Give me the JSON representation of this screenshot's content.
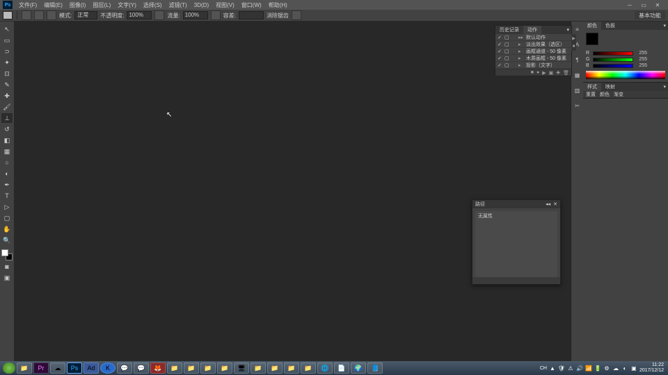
{
  "menubar": {
    "app": "Ps",
    "items": [
      "文件(F)",
      "编辑(E)",
      "图像(I)",
      "图层(L)",
      "文字(Y)",
      "选择(S)",
      "滤镜(T)",
      "3D(D)",
      "视图(V)",
      "窗口(W)",
      "帮助(H)"
    ]
  },
  "optionsbar": {
    "mode_label": "模式:",
    "mode_value": "正常",
    "opacity_label": "不透明度:",
    "opacity_value": "100%",
    "flow_label": "流量:",
    "flow_value": "100%",
    "tolerance_label": "容差:",
    "tolerance_value": "",
    "antialias_label": "消除锯齿",
    "workspace_switch": "基本功能"
  },
  "actions_panel": {
    "tab1": "历史记录",
    "tab2": "动作",
    "rows": [
      {
        "name": "默认动作",
        "folder": true
      },
      {
        "name": "淡出效果（选区）"
      },
      {
        "name": "画框通道 - 50 像素"
      },
      {
        "name": "木质画框 - 50 像素"
      },
      {
        "name": "投影（文字）"
      }
    ]
  },
  "color_panel": {
    "tab1": "颜色",
    "tab2": "色板",
    "r": "255",
    "g": "255",
    "b": "255"
  },
  "sub_panel": {
    "tab1": "样式",
    "tab2": "映射",
    "items": [
      "重置",
      "颜色",
      "渐变"
    ]
  },
  "paths_panel": {
    "title": "路径",
    "content": "无属性"
  },
  "taskbar": {
    "time": "11:22",
    "date": "2017/12/12",
    "lang": "CH"
  }
}
